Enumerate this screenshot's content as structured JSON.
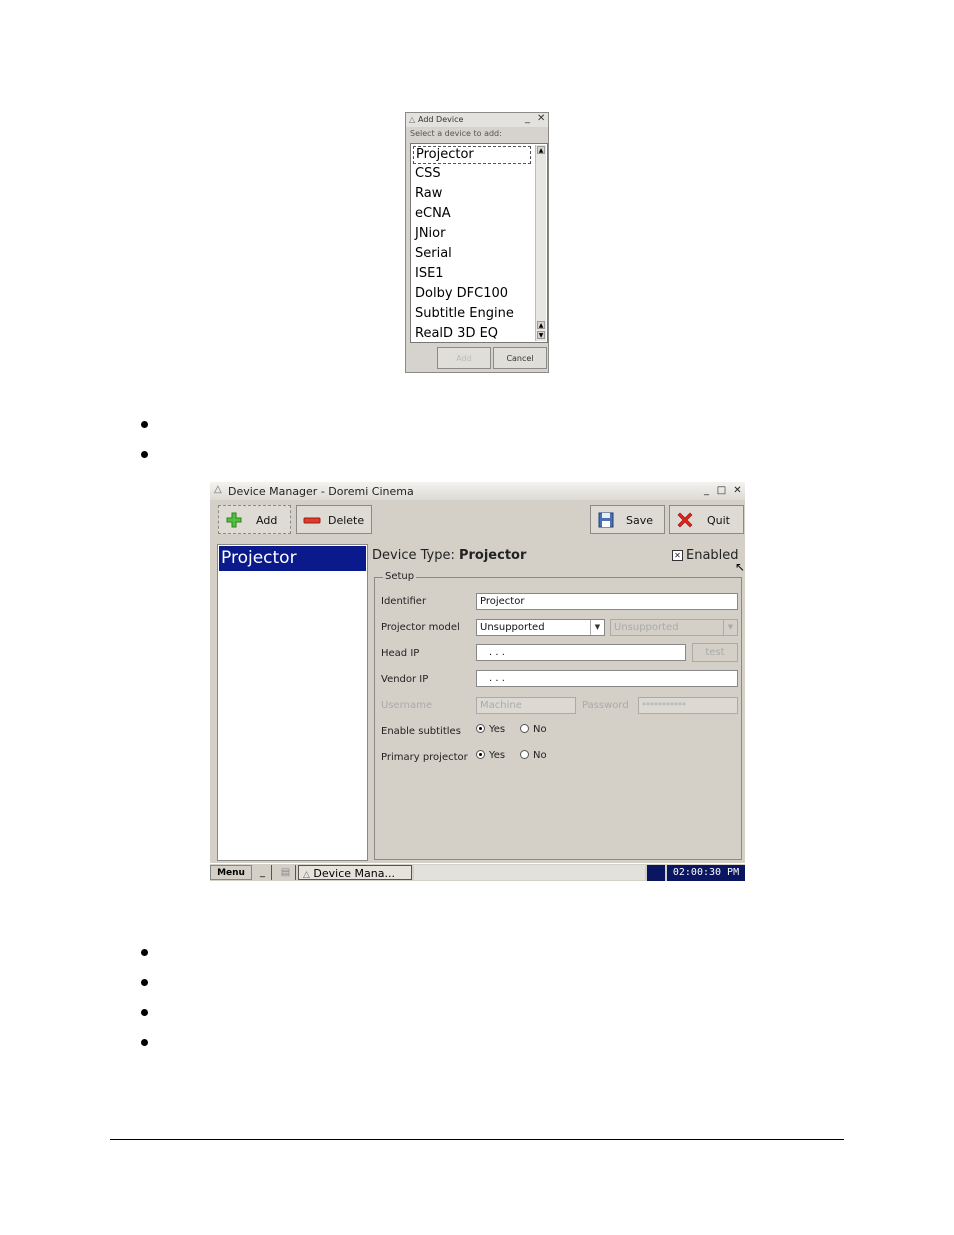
{
  "add_device": {
    "title": "Add Device",
    "prompt": "Select a device to add:",
    "items": [
      "Projector",
      "CSS",
      "Raw",
      "eCNA",
      "JNior",
      "Serial",
      "ISE1",
      "Dolby DFC100",
      "Subtitle Engine",
      "RealD 3D EQ"
    ],
    "selected_index": 0,
    "add_label": "Add",
    "cancel_label": "Cancel"
  },
  "device_manager": {
    "title": "Device Manager - Doremi Cinema",
    "toolbar": {
      "add_label": "Add",
      "delete_label": "Delete",
      "save_label": "Save",
      "quit_label": "Quit"
    },
    "device_list": [
      "Projector"
    ],
    "device_type_label": "Device Type:",
    "device_type_value": "Projector",
    "enabled_label": "Enabled",
    "enabled_checked": true,
    "setup": {
      "legend": "Setup",
      "identifier_label": "Identifier",
      "identifier_value": "Projector",
      "projector_model_label": "Projector model",
      "projector_model_value": "Unsupported",
      "projector_model_sub_value": "Unsupported",
      "head_ip_label": "Head IP",
      "head_ip_value": ". . .",
      "test_label": "test",
      "vendor_ip_label": "Vendor IP",
      "vendor_ip_value": ". . .",
      "username_label": "Username",
      "username_value": "Machine",
      "password_label": "Password",
      "password_value": "***********",
      "enable_subtitles_label": "Enable subtitles",
      "primary_projector_label": "Primary projector",
      "yes_label": "Yes",
      "no_label": "No",
      "enable_subtitles_value": "Yes",
      "primary_projector_value": "Yes"
    },
    "taskbar": {
      "menu_label": "Menu",
      "min_label": "_",
      "task_label": "Device Mana...",
      "clock": "02:00:30 PM"
    }
  },
  "colors": {
    "selection": "#0a1a8c",
    "clock_bg": "#0b1660",
    "window_bg": "#d4d0c8"
  }
}
